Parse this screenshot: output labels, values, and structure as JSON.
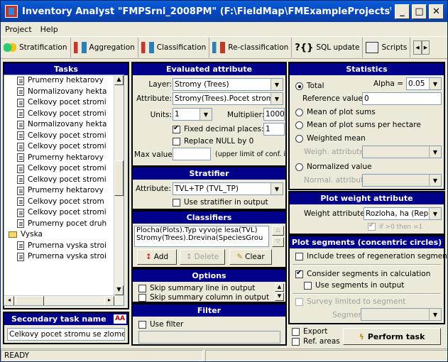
{
  "window": {
    "title": "Inventory Analyst \"FMPSrni_2008PM\" (F:\\FieldMap\\FMExampleProjects\\FMPSrni_2▾...",
    "min": "_",
    "max": "□",
    "close": "✕"
  },
  "menu": [
    "Project",
    "Help"
  ],
  "toolbar": {
    "stratification": "Stratification",
    "aggregation": "Aggregation",
    "classification": "Classification",
    "reclassification": "Re-classification",
    "sql_update": "SQL update",
    "scripts": "Scripts"
  },
  "tasks": {
    "header": "Tasks",
    "items": [
      {
        "t": "Prumerny hektarovy",
        "i": "doc"
      },
      {
        "t": "Normalizovany hekta",
        "i": "doc"
      },
      {
        "t": "Celkovy pocet stromi",
        "i": "doc"
      },
      {
        "t": "Celkovy pocet stromi",
        "i": "doc"
      },
      {
        "t": "Normalizovany hekta",
        "i": "doc"
      },
      {
        "t": "Celkovy pocet stromi",
        "i": "doc"
      },
      {
        "t": "Celkovy pocet stromi",
        "i": "doc"
      },
      {
        "t": "Prumerny hektarovy",
        "i": "doc"
      },
      {
        "t": "Celkovy pocet stromi",
        "i": "doc"
      },
      {
        "t": "Celkovy pocet stromi",
        "i": "doc"
      },
      {
        "t": "Prumerny hektarovy",
        "i": "doc"
      },
      {
        "t": "Celkovy pocet strom",
        "i": "doc"
      },
      {
        "t": "Celkovy pocet stromi",
        "i": "doc"
      },
      {
        "t": "Prumerny pocet druh",
        "i": "doc"
      },
      {
        "t": "Vyska",
        "i": "folder"
      },
      {
        "t": "Prumerna vyska stroi",
        "i": "doc"
      },
      {
        "t": "Prumerna vyska stroi",
        "i": "doc"
      }
    ]
  },
  "secondary": {
    "header": "Secondary task name",
    "value": "Celkovy pocet stromu se zlome"
  },
  "evaluated": {
    "header": "Evaluated attribute",
    "layer_label": "Layer:",
    "layer": "Stromy (Trees)",
    "attribute_label": "Attribute:",
    "attribute": "Stromy(Trees).Pocet stromu(",
    "units_label": "Units:",
    "units": "1",
    "multiplier_label": "Multiplier:",
    "multiplier": "1000",
    "fixed_label": "Fixed decimal places:",
    "fixed_value": "1",
    "replace_label": "Replace NULL by 0",
    "max_label": "Max value:",
    "max_value": "",
    "max_hint": "(upper limit of conf. int.)"
  },
  "stratifier": {
    "header": "Stratifier",
    "attribute_label": "Attribute:",
    "attribute": "TVL+TP (TVL_TP)",
    "use_label": "Use stratifier in output"
  },
  "classifiers": {
    "header": "Classifiers",
    "items": [
      "Plocha(Plots).Typ vyvoje lesa(TVL)",
      "Stromy(Trees).Drevina(SpeciesGrou"
    ],
    "add": "Add",
    "delete": "Delete",
    "clear": "Clear"
  },
  "options": {
    "header": "Options",
    "items": [
      "Skip summary line in output",
      "Skip summary column in output"
    ]
  },
  "filter": {
    "header": "Filter",
    "use_label": "Use filter",
    "value": ""
  },
  "statistics": {
    "header": "Statistics",
    "total": "Total",
    "alpha_label": "Alpha =",
    "alpha": "0.05",
    "ref_label": "Reference value:",
    "ref_value": "0",
    "mean_sums": "Mean of plot sums",
    "mean_ha": "Mean of plot sums per hectare",
    "weighted": "Weighted mean",
    "weigh_attr": "Weigh. attribute:",
    "normalized": "Normalized value",
    "normal_attr": "Normal. attribute:"
  },
  "plotweight": {
    "header": "Plot weight attribute",
    "label": "Weight attribute:",
    "value": "Rozloha, ha (Repre",
    "hint": "if >0 then =1"
  },
  "segments": {
    "header": "Plot segments (concentric circles)",
    "include": "Include trees of regeneration segment",
    "consider": "Consider segments in calculation",
    "use_seg": "Use segments in output",
    "survey": "Survey limited to segment",
    "segment_label": "Segment:"
  },
  "bottom": {
    "export": "Export",
    "ref_areas": "Ref. areas",
    "perform": "Perform task"
  },
  "status": {
    "text": "READY"
  }
}
